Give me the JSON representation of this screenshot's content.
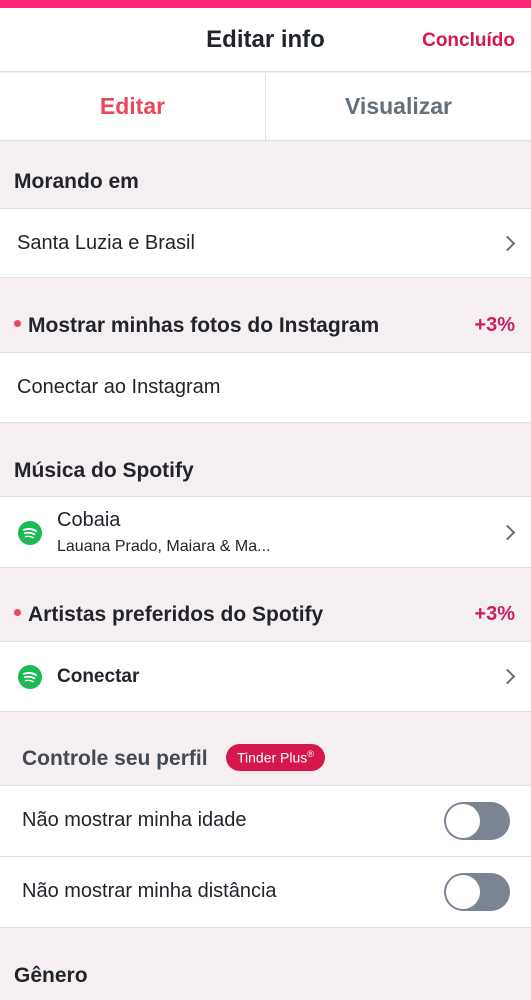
{
  "header": {
    "title": "Editar info",
    "done_label": "Concluído"
  },
  "tabs": {
    "edit": "Editar",
    "preview": "Visualizar"
  },
  "living": {
    "heading": "Morando em",
    "value": "Santa Luzia e Brasil"
  },
  "instagram": {
    "heading": "Mostrar minhas fotos do Instagram",
    "boost": "+3%",
    "connect_label": "Conectar ao Instagram"
  },
  "spotify_music": {
    "heading": "Música do Spotify",
    "song": "Cobaia",
    "artists": "Lauana Prado, Maiara & Ma..."
  },
  "spotify_artists": {
    "heading": "Artistas preferidos do Spotify",
    "boost": "+3%",
    "connect_label": "Conectar"
  },
  "profile_control": {
    "heading": "Controle seu perfil",
    "badge": "Tinder Plus",
    "badge_mark": "®",
    "hide_age_label": "Não mostrar minha idade",
    "hide_age_on": false,
    "hide_distance_label": "Não mostrar minha distância",
    "hide_distance_on": false
  },
  "gender": {
    "heading": "Gênero"
  },
  "colors": {
    "brand": "#d6174c",
    "accent": "#e9485f",
    "spotify": "#1db954",
    "toggle_off": "#7b8592"
  },
  "icons": {
    "spotify": "spotify-icon",
    "chevron": "chevron-right-icon"
  }
}
